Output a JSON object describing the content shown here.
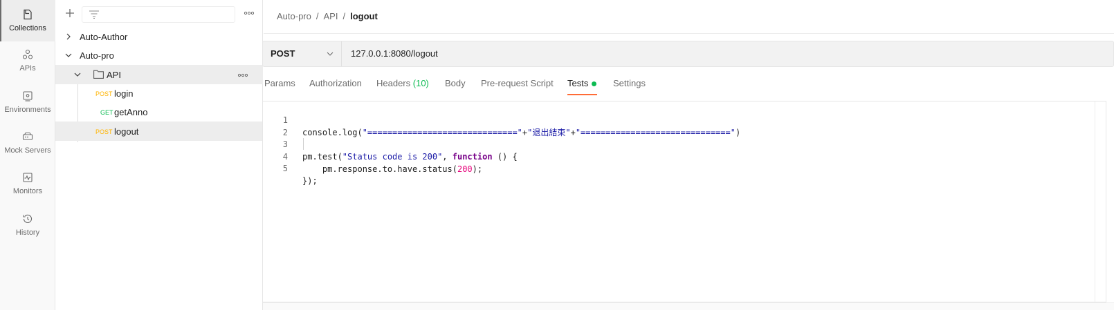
{
  "rail": {
    "items": [
      {
        "label": "Collections",
        "icon": "collections-icon",
        "active": true
      },
      {
        "label": "APIs",
        "icon": "apis-icon",
        "active": false
      },
      {
        "label": "Environments",
        "icon": "environments-icon",
        "active": false
      },
      {
        "label": "Mock Servers",
        "icon": "mock-servers-icon",
        "active": false
      },
      {
        "label": "Monitors",
        "icon": "monitors-icon",
        "active": false
      },
      {
        "label": "History",
        "icon": "history-icon",
        "active": false
      }
    ]
  },
  "sidebar": {
    "tree": [
      {
        "label": "Auto-Author",
        "expanded": false
      },
      {
        "label": "Auto-pro",
        "expanded": true
      },
      {
        "label": "API",
        "type": "folder",
        "expanded": true
      },
      {
        "method": "POST",
        "label": "login"
      },
      {
        "method": "GET",
        "label": "getAnno"
      },
      {
        "method": "POST",
        "label": "logout",
        "selected": true
      }
    ]
  },
  "breadcrumb": {
    "items": [
      "Auto-pro",
      "API"
    ],
    "current": "logout",
    "separator": "/"
  },
  "request": {
    "method": "POST",
    "url": "127.0.0.1:8080/logout"
  },
  "tabs": {
    "params": "Params",
    "authorization": "Authorization",
    "headers": "Headers",
    "headers_count": "(10)",
    "body": "Body",
    "prerequest": "Pre-request Script",
    "tests": "Tests",
    "settings": "Settings",
    "active": "Tests"
  },
  "editor": {
    "line_numbers": [
      "1",
      "2",
      "3",
      "4",
      "5"
    ],
    "line1": {
      "a": "console.log(",
      "b": "\"==============================\"",
      "c": "+",
      "d": "\"退出結束\"",
      "e": "+",
      "f": "\"==============================\"",
      "g": ")"
    },
    "line3": {
      "a": "pm.test(",
      "b": "\"Status code is 200\"",
      "c": ", ",
      "d": "function",
      "e": " () {"
    },
    "line4": {
      "a": "    pm.response.to.have.status(",
      "b": "200",
      "c": ");"
    },
    "line5": "});"
  },
  "colors": {
    "accent": "#ff6c37",
    "post": "#ffb400",
    "get": "#0cbb52",
    "test_dot": "#0cbb52"
  }
}
